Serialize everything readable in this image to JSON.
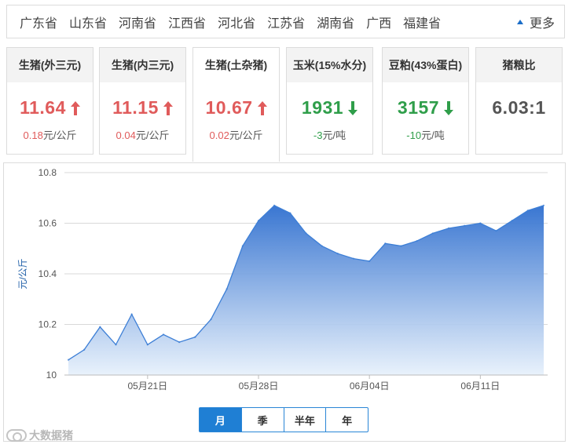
{
  "provinces": {
    "items": [
      "广东省",
      "山东省",
      "河南省",
      "江西省",
      "河北省",
      "江苏省",
      "湖南省",
      "广西",
      "福建省"
    ],
    "more_label": "更多"
  },
  "cards": [
    {
      "title": "生猪(外三元)",
      "value": "11.64",
      "direction": "up",
      "change": "0.18",
      "unit": "元/公斤"
    },
    {
      "title": "生猪(内三元)",
      "value": "11.15",
      "direction": "up",
      "change": "0.04",
      "unit": "元/公斤"
    },
    {
      "title": "生猪(土杂猪)",
      "value": "10.67",
      "direction": "up",
      "change": "0.02",
      "unit": "元/公斤",
      "active": true
    },
    {
      "title": "玉米(15%水分)",
      "value": "1931",
      "direction": "down",
      "change": "-3",
      "unit": "元/吨"
    },
    {
      "title": "豆粕(43%蛋白)",
      "value": "3157",
      "direction": "down",
      "change": "-10",
      "unit": "元/吨"
    },
    {
      "title": "猪粮比",
      "value": "6.03:1",
      "direction": "none",
      "change": "",
      "unit": ""
    }
  ],
  "colors": {
    "up": "#e05b5b",
    "down": "#2f9e4a",
    "accent": "#1f7fd4",
    "line": "#3d7fd6"
  },
  "chart_data": {
    "type": "area",
    "ylabel": "元/公斤",
    "ylim": [
      10.0,
      10.8
    ],
    "yticks": [
      "10",
      "10.2",
      "10.4",
      "10.6",
      "10.8"
    ],
    "xtick_labels": [
      "05月21日",
      "05月28日",
      "06月04日",
      "06月11日"
    ],
    "xtick_index": [
      5,
      12,
      19,
      26
    ],
    "grid": true,
    "x": [
      "05月16日",
      "05月17日",
      "05月18日",
      "05月19日",
      "05月20日",
      "05月21日",
      "05月22日",
      "05月23日",
      "05月24日",
      "05月25日",
      "05月26日",
      "05月27日",
      "05月28日",
      "05月29日",
      "05月30日",
      "05月31日",
      "06月01日",
      "06月02日",
      "06月03日",
      "06月04日",
      "06月05日",
      "06月06日",
      "06月07日",
      "06月08日",
      "06月09日",
      "06月10日",
      "06月11日",
      "06月12日",
      "06月13日",
      "06月14日",
      "06月15日"
    ],
    "series": [
      {
        "values": [
          10.06,
          10.1,
          10.19,
          10.12,
          10.24,
          10.12,
          10.16,
          10.13,
          10.15,
          10.22,
          10.34,
          10.51,
          10.61,
          10.67,
          10.64,
          10.56,
          10.51,
          10.48,
          10.46,
          10.45,
          10.52,
          10.51,
          10.53,
          10.56,
          10.58,
          10.59,
          10.6,
          10.57,
          10.61,
          10.65,
          10.67
        ]
      }
    ]
  },
  "period_tabs": {
    "items": [
      "月",
      "季",
      "半年",
      "年"
    ],
    "active": "月"
  },
  "watermark": {
    "text": "大数据猪"
  }
}
